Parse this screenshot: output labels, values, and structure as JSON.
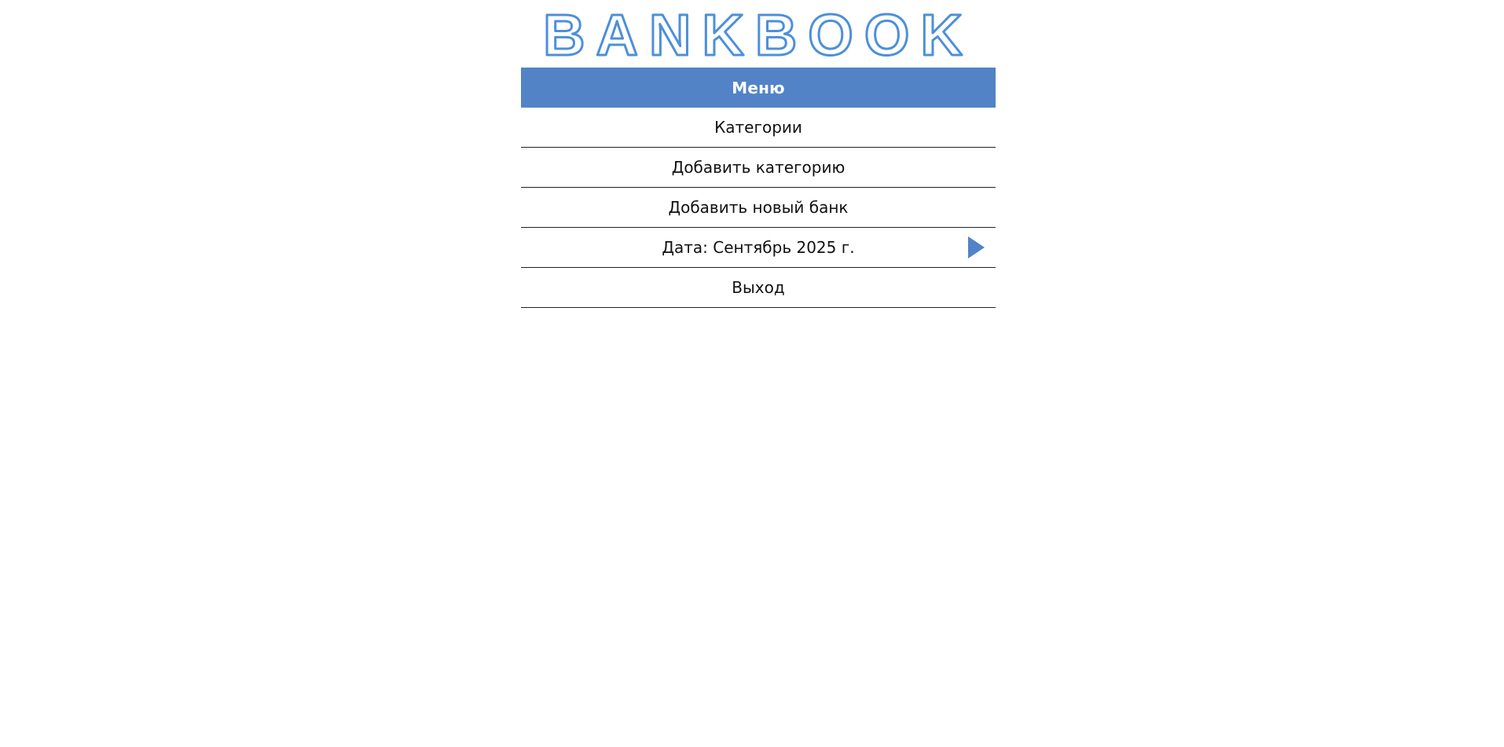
{
  "logo": {
    "text": "BANKBOOK",
    "color": "#4d8fdb"
  },
  "menu": {
    "header": "Меню",
    "header_color": "#5183c6",
    "items": [
      {
        "label": "Категории"
      },
      {
        "label": "Добавить категорию"
      },
      {
        "label": "Добавить новый банк"
      },
      {
        "label": "Дата: Сентябрь 2025 г.",
        "icon": "play-arrow-icon"
      },
      {
        "label": "Выход"
      }
    ]
  }
}
